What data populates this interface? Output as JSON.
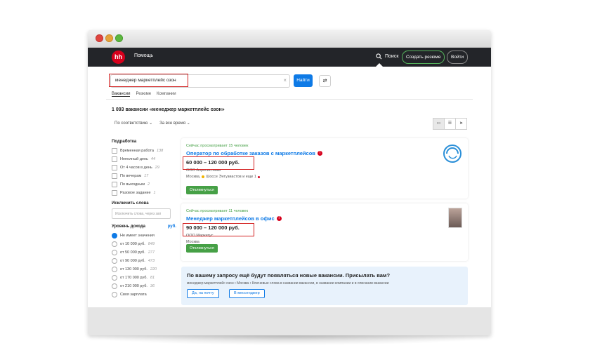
{
  "header": {
    "logo": "hh",
    "help": "Помощь",
    "search": "Поиск",
    "create_resume": "Создать резюме",
    "login": "Войти"
  },
  "search": {
    "query": "менеджер маркетплейс озон",
    "button": "Найти"
  },
  "tabs": [
    "Вакансии",
    "Резюме",
    "Компании"
  ],
  "results": {
    "count_text": "1 093 вакансии «менеджер маркетплейс озон»",
    "sort": "По соответствию",
    "period": "За все время"
  },
  "sidebar": {
    "details_title": "Подработка",
    "details": [
      {
        "label": "Временная работа",
        "count": "138"
      },
      {
        "label": "Неполный день",
        "count": "44"
      },
      {
        "label": "От 4 часов в день",
        "count": "29"
      },
      {
        "label": "По вечерам",
        "count": "17"
      },
      {
        "label": "По выходным",
        "count": "2"
      },
      {
        "label": "Разовое задание",
        "count": "1"
      }
    ],
    "exclude_title": "Исключить слова",
    "exclude_placeholder": "Исключить слова, через зап",
    "income_title": "Уровень дохода",
    "income_currency": "руб.",
    "income": [
      {
        "label": "Не имеет значения",
        "count": "",
        "selected": true
      },
      {
        "label": "от 10 000 руб.",
        "count": "849",
        "selected": false
      },
      {
        "label": "от 50 000 руб.",
        "count": "277",
        "selected": false
      },
      {
        "label": "от 90 000 руб.",
        "count": "473",
        "selected": false
      },
      {
        "label": "от 130 000 руб.",
        "count": "220",
        "selected": false
      },
      {
        "label": "от 170 000 руб.",
        "count": "81",
        "selected": false
      },
      {
        "label": "от 210 000 руб.",
        "count": "36",
        "selected": false
      },
      {
        "label": "Своя зарплата",
        "count": "",
        "selected": false
      }
    ]
  },
  "vacancies": [
    {
      "viewers": "Сейчас просматривает 15 человек",
      "title": "Оператор по обработке заказов с маркетплейсов",
      "salary": "60 000 – 120 000 руб.",
      "company": "ООО Аэросистемы",
      "location": "Москва,",
      "metro": "Шоссе Энтузиастов и еще 1",
      "respond": "Откликнуться"
    },
    {
      "viewers": "Сейчас просматривает 11 человек",
      "title": "Менеджер маркетплейсов в офис",
      "salary": "90 000 – 120 000 руб.",
      "company": "ООО Маркетус",
      "location": "Москва",
      "metro": "",
      "respond": "Откликнуться"
    }
  ],
  "subscribe": {
    "title": "По вашему запросу ещё будут появляться новые вакансии. Присылать вам?",
    "text": "менеджер маркетплейс озон • Москва • Ключевые слова в названии вакансии, в названии компании и в описании вакансии",
    "btn_email": "Да, на почту",
    "btn_messenger": "В мессенджер"
  },
  "colors": {
    "brand": "#d6001c",
    "accent": "#0e7ae6",
    "green": "#46a046",
    "highlight": "#d32222"
  }
}
